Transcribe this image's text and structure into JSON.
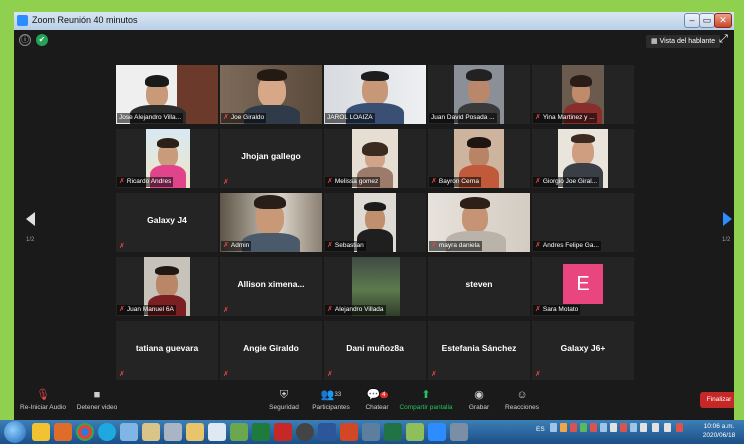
{
  "window": {
    "title": "Zoom Reunión 40 minutos",
    "min_glyph": "–",
    "max_glyph": "▭",
    "close_glyph": "✕"
  },
  "top": {
    "info_glyph": "ⓘ",
    "shield_glyph": "✔",
    "speaker_view_label": "Vista del hablante",
    "fullscreen_glyph": "⤢"
  },
  "grid": {
    "labeled": [
      {
        "name": "Jose Alejandro Villa...",
        "type": "photo"
      },
      {
        "name": "Joe Giraldo",
        "type": "photo"
      },
      {
        "name": "JAROL LOAIZA",
        "type": "photo"
      },
      {
        "name": "Juan David Posada ...",
        "type": "photo"
      },
      {
        "name": "Yina Martinez y ...",
        "type": "photo"
      },
      {
        "name": "Ricardo Andres",
        "type": "photo"
      },
      {
        "name": "Melissa gomez",
        "type": "photo"
      },
      {
        "name": "Bayron Cerna",
        "type": "photo"
      },
      {
        "name": "Giorgio Joe Giral...",
        "type": "photo"
      },
      {
        "name": "Admin",
        "type": "photo"
      },
      {
        "name": "Sebastian",
        "type": "photo"
      },
      {
        "name": "mayra daniela",
        "type": "photo"
      },
      {
        "name": "Andres Felipe Ga...",
        "type": "blank"
      },
      {
        "name": "Juan Manuel 6A",
        "type": "photo"
      },
      {
        "name": "Alejandro Villada",
        "type": "photo"
      },
      {
        "name": "Sara Motato",
        "type": "avatar"
      }
    ],
    "centered": [
      "Jhojan gallego",
      "Galaxy J4",
      "Allison ximena...",
      "steven",
      "tatiana guevara",
      "Angie Giraldo",
      "Dani muñoz8a",
      "Estefania Sánchez",
      "Galaxy J6+"
    ],
    "avatar_letter": "E",
    "page_left": "1/2",
    "page_right": "1/2"
  },
  "toolbar": {
    "audio_label": "Re-Iniciar Audio",
    "video_label": "Detener video",
    "security_label": "Seguridad",
    "participants_label": "Participantes",
    "participants_count": "33",
    "chat_label": "Chatear",
    "chat_badge": "4",
    "share_label": "Compartir pantalla",
    "record_label": "Grabar",
    "reactions_label": "Reacciones",
    "end_label": "Finalizar"
  },
  "taskbar": {
    "lang": "ES",
    "time": "10:06 a.m.",
    "date": "2020/06/18"
  }
}
